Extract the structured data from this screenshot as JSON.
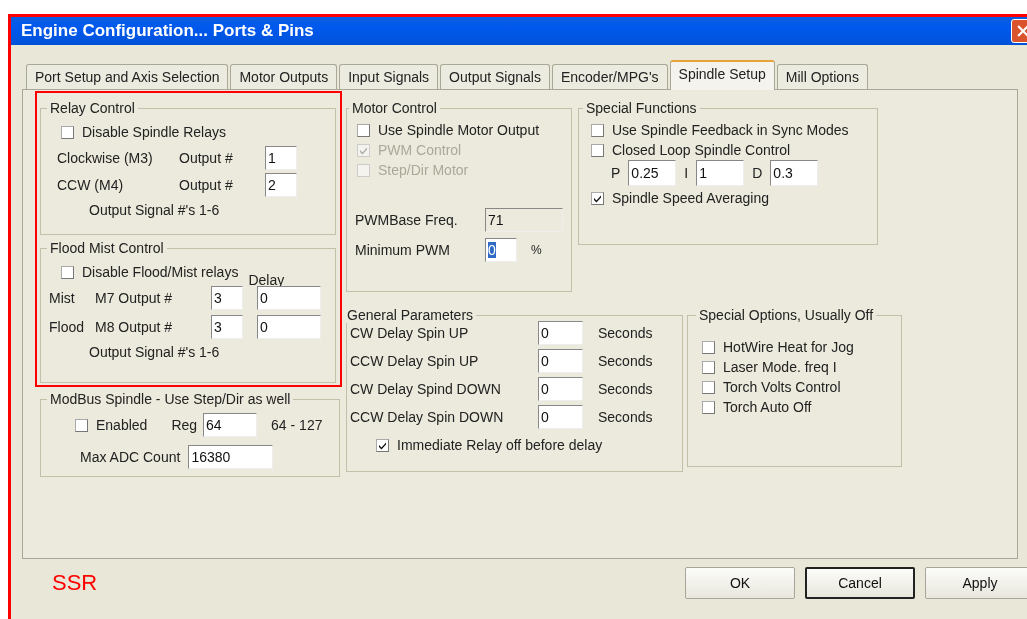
{
  "window": {
    "title": "Engine Configuration... Ports & Pins"
  },
  "tabs": [
    {
      "label": "Port Setup and Axis Selection",
      "selected": false
    },
    {
      "label": "Motor Outputs",
      "selected": false
    },
    {
      "label": "Input Signals",
      "selected": false
    },
    {
      "label": "Output Signals",
      "selected": false
    },
    {
      "label": "Encoder/MPG's",
      "selected": false
    },
    {
      "label": "Spindle Setup",
      "selected": true
    },
    {
      "label": "Mill Options",
      "selected": false
    }
  ],
  "relay_control": {
    "title": "Relay Control",
    "disable_relays": {
      "label": "Disable Spindle Relays",
      "checked": false
    },
    "rows": [
      {
        "label": "Clockwise (M3)",
        "output_label": "Output #",
        "value": "1"
      },
      {
        "label": "CCW (M4)",
        "output_label": "Output #",
        "value": "2"
      }
    ],
    "note": "Output Signal #'s 1-6"
  },
  "flood_mist_control": {
    "title": "Flood Mist Control",
    "disable_relays": {
      "label": "Disable Flood/Mist relays",
      "checked": false
    },
    "delay_heading": "Delay",
    "rows": [
      {
        "label": "Mist",
        "output_label": "M7 Output #",
        "value": "3",
        "delay": "0"
      },
      {
        "label": "Flood",
        "output_label": "M8 Output #",
        "value": "3",
        "delay": "0"
      }
    ],
    "note": "Output Signal #'s 1-6"
  },
  "modbus_spindle": {
    "title": "ModBus Spindle - Use Step/Dir as well",
    "enabled": {
      "label": "Enabled",
      "checked": false
    },
    "reg_label": "Reg",
    "reg": "64",
    "reg_range": "64 - 127",
    "max_adc_label": "Max ADC Count",
    "max_adc": "16380"
  },
  "motor_control": {
    "title": "Motor Control",
    "options": [
      {
        "label": "Use Spindle Motor Output",
        "checked": false,
        "disabled": false
      },
      {
        "label": "PWM Control",
        "checked": true,
        "disabled": true
      },
      {
        "label": "Step/Dir Motor",
        "checked": false,
        "disabled": true
      }
    ],
    "pwm_base_label": "PWMBase Freq.",
    "pwm_base": "71",
    "pwm_base_readonly": true,
    "min_pwm_label": "Minimum PWM",
    "min_pwm": "0",
    "min_pwm_selected": true,
    "min_pwm_unit": "%"
  },
  "special_functions": {
    "title": "Special Functions",
    "options": [
      {
        "label": "Use Spindle Feedback in Sync Modes",
        "checked": false
      },
      {
        "label": "Closed Loop Spindle Control",
        "checked": false
      }
    ],
    "pid": [
      {
        "label": "P",
        "value": "0.25"
      },
      {
        "label": "I",
        "value": "1"
      },
      {
        "label": "D",
        "value": "0.3"
      }
    ],
    "averaging": {
      "label": "Spindle Speed Averaging",
      "checked": true
    }
  },
  "general_parameters": {
    "title": "General Parameters",
    "rows": [
      {
        "label": "CW Delay Spin UP",
        "value": "0",
        "unit": "Seconds"
      },
      {
        "label": "CCW Delay Spin UP",
        "value": "0",
        "unit": "Seconds"
      },
      {
        "label": "CW Delay Spind DOWN",
        "value": "0",
        "unit": "Seconds"
      },
      {
        "label": "CCW Delay Spin DOWN",
        "value": "0",
        "unit": "Seconds"
      }
    ],
    "relay_off": {
      "label": "Immediate Relay off before delay",
      "checked": true
    }
  },
  "special_options": {
    "title": "Special Options, Usually Off",
    "options": [
      {
        "label": "HotWire Heat for Jog",
        "checked": false
      },
      {
        "label": "Laser Mode. freq I",
        "checked": false
      },
      {
        "label": "Torch Volts Control",
        "checked": false
      },
      {
        "label": "Torch Auto Off",
        "checked": false
      }
    ]
  },
  "annotation": {
    "label": "SSR"
  },
  "buttons": [
    {
      "label": "OK",
      "focused": false
    },
    {
      "label": "Cancel",
      "focused": true
    },
    {
      "label": "Apply",
      "focused": false
    }
  ]
}
